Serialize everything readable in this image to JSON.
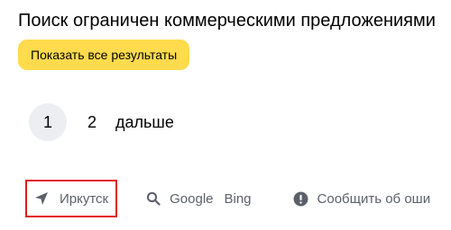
{
  "notice": {
    "title": "Поиск ограничен коммерческими предложениями",
    "show_all_label": "Показать все результаты",
    "accent_color": "#ffdb4d"
  },
  "pagination": {
    "current": "1",
    "pages": [
      "2"
    ],
    "next_label": "дальше"
  },
  "footer": {
    "region": {
      "icon": "location-arrow-icon",
      "label": "Иркутск",
      "highlight_color": "#e01b1b"
    },
    "search_engines": {
      "icon": "search-icon",
      "items": [
        "Google",
        "Bing"
      ]
    },
    "report": {
      "icon": "exclamation-circle-icon",
      "label": "Сообщить об оши"
    }
  }
}
